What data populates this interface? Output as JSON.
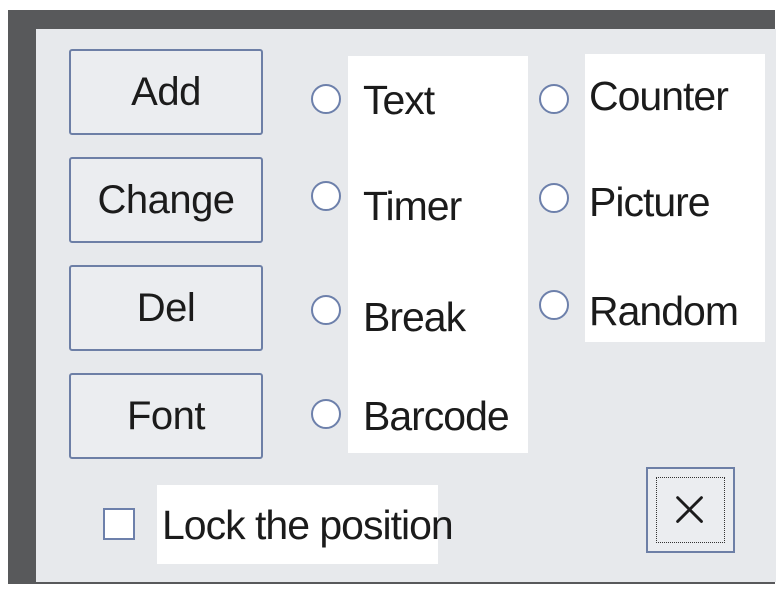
{
  "buttons": {
    "add_label": "Add",
    "change_label": "Change",
    "del_label": "Del",
    "font_label": "Font"
  },
  "object_types": [
    {
      "label": "Text",
      "selected": false
    },
    {
      "label": "Timer",
      "selected": false
    },
    {
      "label": "Break",
      "selected": false
    },
    {
      "label": "Barcode",
      "selected": false
    },
    {
      "label": "Counter",
      "selected": false
    },
    {
      "label": "Picture",
      "selected": false
    },
    {
      "label": "Random",
      "selected": false
    }
  ],
  "lock_position": {
    "label": "Lock the position",
    "checked": false
  },
  "close_button": {
    "icon": "close-icon"
  },
  "colors": {
    "frame": "#58595b",
    "panel": "#e7e9ec",
    "control_border": "#6d7fa6"
  }
}
